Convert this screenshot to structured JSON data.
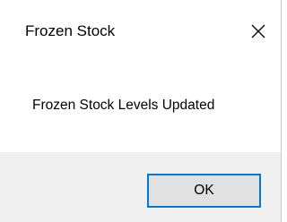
{
  "dialog": {
    "title": "Frozen Stock",
    "message": "Frozen Stock Levels Updated",
    "close_icon": "close-icon",
    "buttons": {
      "ok_label": "OK"
    }
  },
  "colors": {
    "background": "#ffffff",
    "footer_background": "#f0f0f0",
    "button_background": "#e1e1e1",
    "button_focus_border": "#0078d7"
  }
}
